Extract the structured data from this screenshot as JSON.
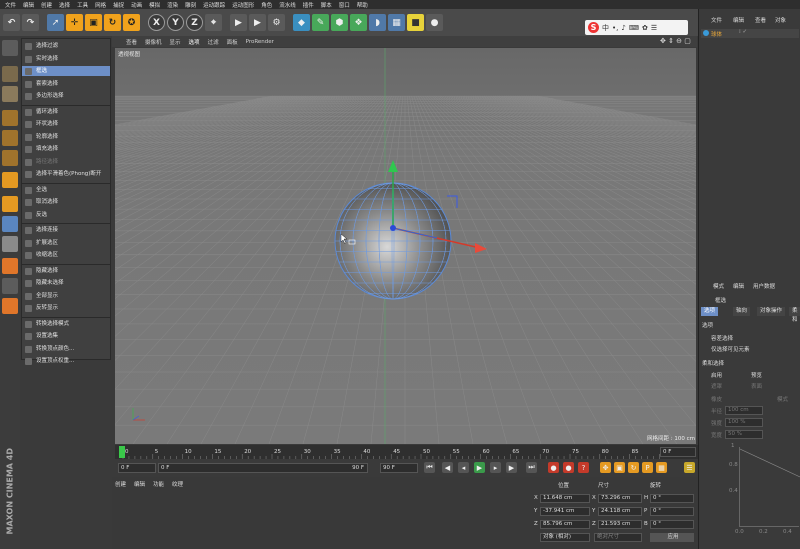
{
  "menubar": [
    "文件",
    "编辑",
    "创建",
    "选择",
    "工具",
    "网格",
    "捕捉",
    "动画",
    "模拟",
    "渲染",
    "雕刻",
    "运动跟踪",
    "运动图形",
    "角色",
    "流水线",
    "插件",
    "脚本",
    "窗口",
    "帮助"
  ],
  "ime": {
    "logo": "S",
    "label": "中"
  },
  "select_menu": {
    "items": [
      {
        "label": "选择过滤",
        "state": "normal"
      },
      {
        "label": "实时选择",
        "state": "normal"
      },
      {
        "label": "框选",
        "state": "selected"
      },
      {
        "label": "套索选择",
        "state": "normal"
      },
      {
        "label": "多边形选择",
        "state": "normal"
      },
      {
        "label": "循环选择",
        "state": "normal"
      },
      {
        "label": "环状选择",
        "state": "normal"
      },
      {
        "label": "轮廓选择",
        "state": "normal"
      },
      {
        "label": "填充选择",
        "state": "normal"
      },
      {
        "label": "路径选择",
        "state": "dim"
      },
      {
        "label": "选择平滑着色(Phong)断开",
        "state": "normal"
      },
      {
        "label": "全选",
        "state": "normal"
      },
      {
        "label": "取消选择",
        "state": "normal"
      },
      {
        "label": "反选",
        "state": "normal"
      },
      {
        "label": "选择连接",
        "state": "normal"
      },
      {
        "label": "扩展选区",
        "state": "normal"
      },
      {
        "label": "收缩选区",
        "state": "normal"
      },
      {
        "label": "隐藏选择",
        "state": "normal"
      },
      {
        "label": "隐藏未选择",
        "state": "normal"
      },
      {
        "label": "全部显示",
        "state": "normal"
      },
      {
        "label": "反转显示",
        "state": "normal"
      },
      {
        "label": "转换选择模式",
        "state": "normal"
      },
      {
        "label": "设置选集",
        "state": "normal"
      },
      {
        "label": "转换顶点颜色...",
        "state": "normal"
      },
      {
        "label": "设置顶点权重...",
        "state": "normal"
      }
    ]
  },
  "viewport": {
    "menu": [
      "查看",
      "摄像机",
      "显示",
      "选项",
      "过滤",
      "面板",
      "ProRender"
    ],
    "active_menu": "选项",
    "label": "透视视图",
    "grid_info": "网格间距 : 100 cm"
  },
  "timeline": {
    "ticks": [
      "0",
      "5",
      "10",
      "15",
      "20",
      "25",
      "30",
      "35",
      "40",
      "45",
      "50",
      "55",
      "60",
      "65",
      "70",
      "75",
      "80",
      "85",
      "90"
    ],
    "current": "0 F",
    "start": "0 F",
    "range_start": "0 F",
    "range_end": "90 F",
    "end": "90 F",
    "right_field": "0 F"
  },
  "bottom_panel": {
    "tabs": [
      "创建",
      "编辑",
      "功能",
      "纹理"
    ]
  },
  "coords": {
    "headers": [
      "位置",
      "尺寸",
      "旋转"
    ],
    "rows": [
      {
        "axis": "X",
        "pos": "11.648 cm",
        "size": "73.296 cm",
        "rot_axis": "H",
        "rot": "0 °"
      },
      {
        "axis": "Y",
        "pos": "-37.941 cm",
        "size": "24.118 cm",
        "rot_axis": "P",
        "rot": "0 °"
      },
      {
        "axis": "Z",
        "pos": "85.796 cm",
        "size": "21.593 cm",
        "rot_axis": "B",
        "rot": "0 °"
      }
    ],
    "mode": "对象 (相对)",
    "size_mode": "绝对尺寸",
    "apply": "应用"
  },
  "object_manager": {
    "menu": [
      "文件",
      "编辑",
      "查看",
      "对象"
    ],
    "object": "球体"
  },
  "attribute_manager": {
    "menu": [
      "模式",
      "编辑",
      "用户数据"
    ],
    "title": "框选",
    "tabs": [
      "选项",
      "轴向",
      "对象操作",
      "柔和"
    ],
    "section_options": "选项",
    "opt1": "容差选择",
    "opt2": "仅选择可见元素",
    "section_soft": "柔和选择",
    "soft_enable": "启用",
    "soft_preview": "预览",
    "mask": "遮罩",
    "surface": "表面",
    "rubber": "橡皮",
    "radius_label": "半径",
    "radius_val": "100 cm",
    "strength_label": "强度",
    "strength_val": "100 %",
    "width_label": "宽度",
    "width_val": "50 %",
    "mode_label": "模式",
    "graph_y1": "1",
    "graph_y2": "0.8",
    "graph_y3": "0.4",
    "graph_x1": "0.0",
    "graph_x2": "0.2",
    "graph_x3": "0.4"
  },
  "brand": "MAXON CINEMA 4D"
}
